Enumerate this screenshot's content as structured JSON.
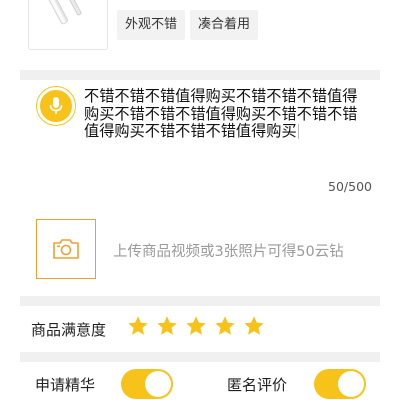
{
  "product": {
    "thumbnail": "product-thumbnail",
    "tags": [
      "外观不错",
      "凑合着用"
    ]
  },
  "review": {
    "mic_icon": "microphone-icon",
    "text": "不错不错不错值得购买不错不错不错值得购买不错不错不错值得购买不错不错不错值得购买不错不错不错值得购买",
    "counter": "50/500"
  },
  "upload": {
    "icon": "camera-icon",
    "hint": "上传商品视频或3张照片可得50云钻"
  },
  "satisfaction": {
    "label": "商品满意度",
    "rating": 5,
    "max": 5
  },
  "options": {
    "featured_label": "申请精华",
    "featured_on": true,
    "anonymous_label": "匿名评价",
    "anonymous_on": true
  },
  "colors": {
    "accent": "#f7c21a",
    "upload_border": "#f0a032",
    "divider": "#f0f0f0"
  }
}
